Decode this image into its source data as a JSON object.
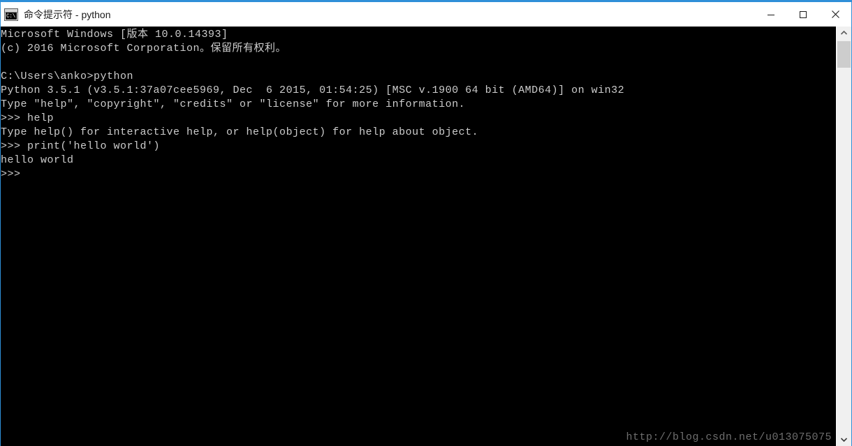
{
  "window": {
    "title": "命令提示符 - python",
    "icon": "cmd-console-icon",
    "icon_glyph": "C:\\",
    "border_color": "#2f8fd8",
    "controls": [
      {
        "name": "minimize",
        "label": "—"
      },
      {
        "name": "maximize",
        "label": "▢"
      },
      {
        "name": "close",
        "label": "✕"
      }
    ]
  },
  "console": {
    "background": "#000000",
    "foreground": "#cccccc",
    "lines": [
      "Microsoft Windows [版本 10.0.14393]",
      "(c) 2016 Microsoft Corporation。保留所有权利。",
      "",
      "C:\\Users\\anko>python",
      "Python 3.5.1 (v3.5.1:37a07cee5969, Dec  6 2015, 01:54:25) [MSC v.1900 64 bit (AMD64)] on win32",
      "Type \"help\", \"copyright\", \"credits\" or \"license\" for more information.",
      ">>> help",
      "Type help() for interactive help, or help(object) for help about object.",
      ">>> print('hello world')",
      "hello world",
      ">>>"
    ],
    "watermark": "http://blog.csdn.net/u013075075"
  },
  "scrollbar": {
    "up_arrow": "scroll-up-arrow",
    "down_arrow": "scroll-down-arrow",
    "track_color": "#f0f0f0",
    "thumb_color": "#cdcdcd"
  }
}
